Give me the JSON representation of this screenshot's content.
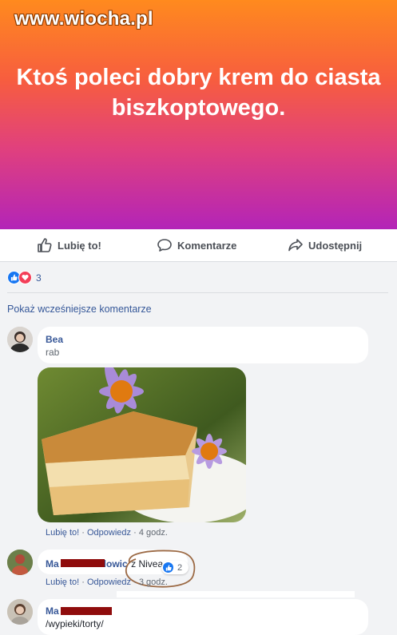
{
  "watermark": "www.wiocha.pl",
  "post": {
    "text": "Ktoś poleci dobry krem do ciasta biszkoptowego."
  },
  "actions": {
    "like": "Lubię to!",
    "comment": "Komentarze",
    "share": "Udostępnij"
  },
  "reactions": {
    "count": "3"
  },
  "more_comments": "Pokaż wcześniejsze komentarze",
  "comments": [
    {
      "name": "Bea",
      "text": "rab",
      "meta_like": "Lubię to!",
      "meta_reply": "Odpowiedz",
      "meta_time": "4 godz."
    },
    {
      "name_start": "Ma",
      "name_end": "lowic",
      "text": "z Nivea",
      "likes": "2",
      "meta_like": "Lubię to!",
      "meta_reply": "Odpowiedz",
      "meta_time": "3 godz."
    },
    {
      "name": "Ma",
      "text": "/wypieki/torty/"
    }
  ],
  "colors": {
    "gradient_top": "#ff8a1e",
    "gradient_bottom": "#b324b8",
    "link": "#385898",
    "like_blue": "#1877f2",
    "love_red": "#f33e58"
  }
}
